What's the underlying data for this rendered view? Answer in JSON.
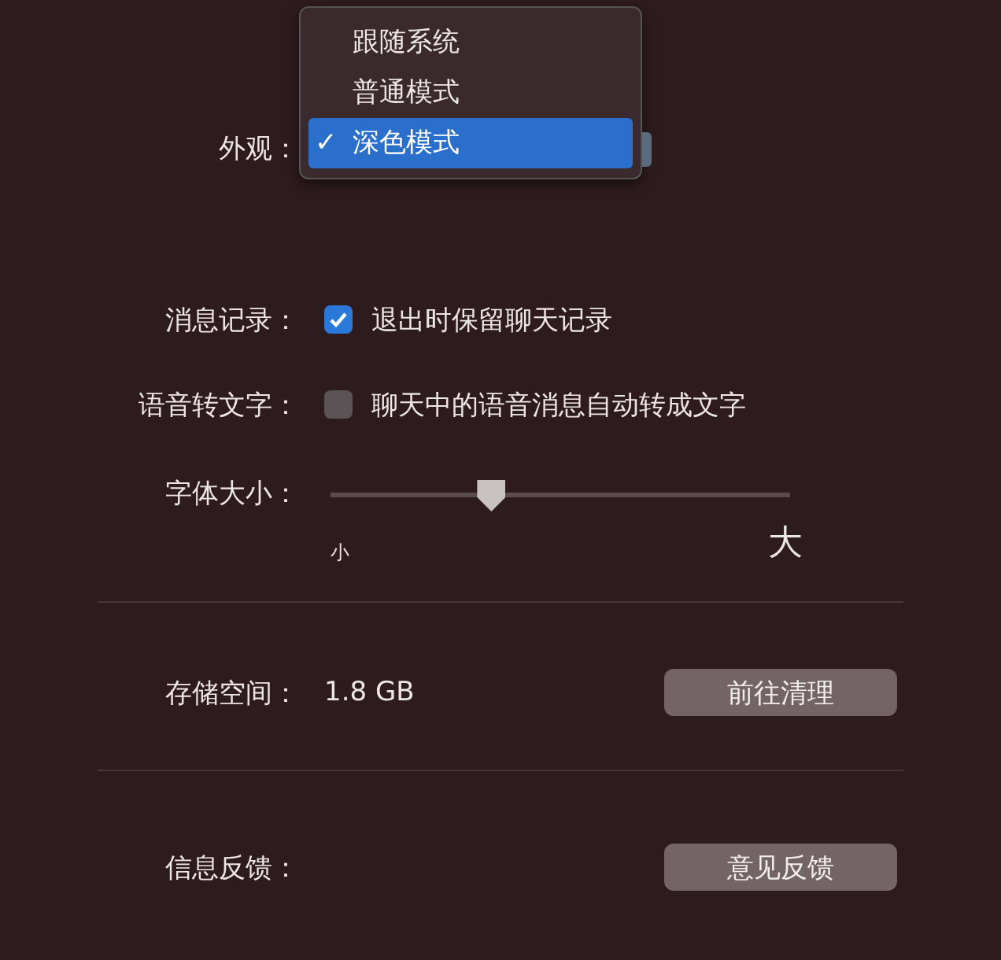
{
  "appearance": {
    "label": "外观：",
    "options": [
      {
        "label": "跟随系统",
        "selected": false
      },
      {
        "label": "普通模式",
        "selected": false
      },
      {
        "label": "深色模式",
        "selected": true
      }
    ],
    "check_mark": "✓"
  },
  "message_history": {
    "label": "消息记录：",
    "text": "退出时保留聊天记录",
    "checked": true
  },
  "voice_to_text": {
    "label": "语音转文字：",
    "text": "聊天中的语音消息自动转成文字",
    "checked": false
  },
  "font_size": {
    "label": "字体大小：",
    "level": 0.35,
    "min_label": "小",
    "max_label": "大"
  },
  "storage": {
    "label": "存储空间：",
    "value": "1.8 GB",
    "button": "前往清理"
  },
  "feedback": {
    "label": "信息反馈：",
    "button": "意见反馈"
  }
}
